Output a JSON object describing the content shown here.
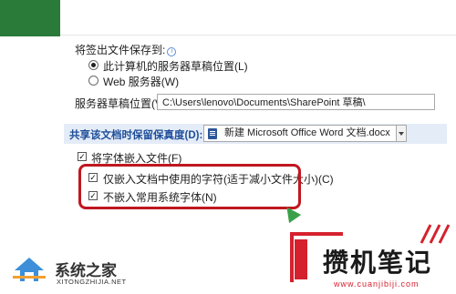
{
  "dialog": {
    "save_to_label": "将签出文件保存到:",
    "radio_local_label": "此计算机的服务器草稿位置(L)",
    "radio_web_label": "Web 服务器(W)",
    "server_draft_label": "服务器草稿位置(V):",
    "server_draft_path": "C:\\Users\\lenovo\\Documents\\SharePoint 草稿\\",
    "fidelity_section_label": "共享该文档时保留保真度(D):",
    "fidelity_document": "新建 Microsoft Office Word 文档.docx",
    "embed_fonts_label": "将字体嵌入文件(F)",
    "embed_used_chars_label": "仅嵌入文档中使用的字符(适于减小文件大小)(C)",
    "no_common_fonts_label": "不嵌入常用系统字体(N)",
    "radio_local_checked": true,
    "radio_web_checked": false,
    "embed_fonts_checked": true,
    "embed_used_chars_checked": true,
    "no_common_fonts_checked": true
  },
  "watermarks": {
    "left_logo_text": "系统之家",
    "left_logo_sub": "XITONGZHIJIA.NET",
    "right_logo_text": "攒机笔记",
    "right_logo_url": "www.cuanjibiji.com"
  },
  "colors": {
    "accent_green": "#2a7a3a",
    "section_blue": "#1f4e9a",
    "highlight_red": "#c0171f",
    "cursor_green": "#3aa14a"
  },
  "icons": {
    "help": "info-circle",
    "document": "word-doc",
    "dropdown": "chevron-down",
    "cursor": "arrow-pointer"
  }
}
